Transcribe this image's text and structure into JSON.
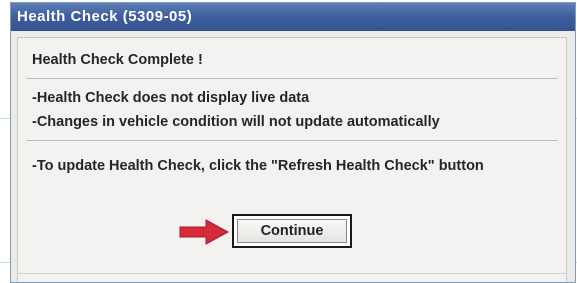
{
  "window": {
    "title": "Health Check (5309-05)"
  },
  "messages": {
    "heading": "Health Check Complete !",
    "line1": "-Health Check does not display live data",
    "line2": "-Changes in vehicle condition will not update automatically",
    "line3": "-To update Health Check, click the \"Refresh Health Check\" button"
  },
  "buttons": {
    "continue_label": "Continue"
  },
  "colors": {
    "titlebar": "#3f5f9f",
    "arrow": "#d42a3a",
    "dialog_bg": "#ecebe8"
  },
  "icons": {
    "pointer": "arrow-right-icon"
  }
}
